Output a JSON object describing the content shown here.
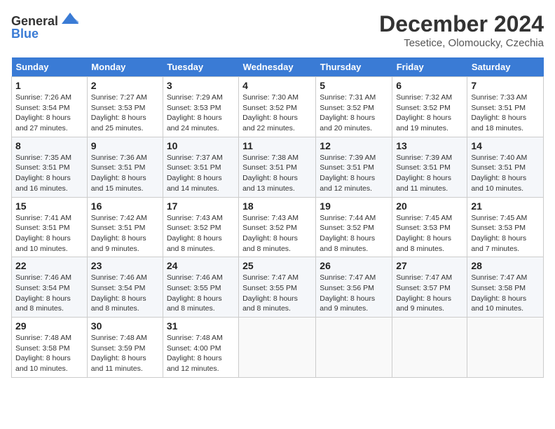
{
  "logo": {
    "text_general": "General",
    "text_blue": "Blue"
  },
  "header": {
    "month": "December 2024",
    "location": "Tesetice, Olomoucky, Czechia"
  },
  "weekdays": [
    "Sunday",
    "Monday",
    "Tuesday",
    "Wednesday",
    "Thursday",
    "Friday",
    "Saturday"
  ],
  "weeks": [
    [
      {
        "day": "1",
        "sunrise": "7:26 AM",
        "sunset": "3:54 PM",
        "daylight": "8 hours and 27 minutes."
      },
      {
        "day": "2",
        "sunrise": "7:27 AM",
        "sunset": "3:53 PM",
        "daylight": "8 hours and 25 minutes."
      },
      {
        "day": "3",
        "sunrise": "7:29 AM",
        "sunset": "3:53 PM",
        "daylight": "8 hours and 24 minutes."
      },
      {
        "day": "4",
        "sunrise": "7:30 AM",
        "sunset": "3:52 PM",
        "daylight": "8 hours and 22 minutes."
      },
      {
        "day": "5",
        "sunrise": "7:31 AM",
        "sunset": "3:52 PM",
        "daylight": "8 hours and 20 minutes."
      },
      {
        "day": "6",
        "sunrise": "7:32 AM",
        "sunset": "3:52 PM",
        "daylight": "8 hours and 19 minutes."
      },
      {
        "day": "7",
        "sunrise": "7:33 AM",
        "sunset": "3:51 PM",
        "daylight": "8 hours and 18 minutes."
      }
    ],
    [
      {
        "day": "8",
        "sunrise": "7:35 AM",
        "sunset": "3:51 PM",
        "daylight": "8 hours and 16 minutes."
      },
      {
        "day": "9",
        "sunrise": "7:36 AM",
        "sunset": "3:51 PM",
        "daylight": "8 hours and 15 minutes."
      },
      {
        "day": "10",
        "sunrise": "7:37 AM",
        "sunset": "3:51 PM",
        "daylight": "8 hours and 14 minutes."
      },
      {
        "day": "11",
        "sunrise": "7:38 AM",
        "sunset": "3:51 PM",
        "daylight": "8 hours and 13 minutes."
      },
      {
        "day": "12",
        "sunrise": "7:39 AM",
        "sunset": "3:51 PM",
        "daylight": "8 hours and 12 minutes."
      },
      {
        "day": "13",
        "sunrise": "7:39 AM",
        "sunset": "3:51 PM",
        "daylight": "8 hours and 11 minutes."
      },
      {
        "day": "14",
        "sunrise": "7:40 AM",
        "sunset": "3:51 PM",
        "daylight": "8 hours and 10 minutes."
      }
    ],
    [
      {
        "day": "15",
        "sunrise": "7:41 AM",
        "sunset": "3:51 PM",
        "daylight": "8 hours and 10 minutes."
      },
      {
        "day": "16",
        "sunrise": "7:42 AM",
        "sunset": "3:51 PM",
        "daylight": "8 hours and 9 minutes."
      },
      {
        "day": "17",
        "sunrise": "7:43 AM",
        "sunset": "3:52 PM",
        "daylight": "8 hours and 8 minutes."
      },
      {
        "day": "18",
        "sunrise": "7:43 AM",
        "sunset": "3:52 PM",
        "daylight": "8 hours and 8 minutes."
      },
      {
        "day": "19",
        "sunrise": "7:44 AM",
        "sunset": "3:52 PM",
        "daylight": "8 hours and 8 minutes."
      },
      {
        "day": "20",
        "sunrise": "7:45 AM",
        "sunset": "3:53 PM",
        "daylight": "8 hours and 8 minutes."
      },
      {
        "day": "21",
        "sunrise": "7:45 AM",
        "sunset": "3:53 PM",
        "daylight": "8 hours and 7 minutes."
      }
    ],
    [
      {
        "day": "22",
        "sunrise": "7:46 AM",
        "sunset": "3:54 PM",
        "daylight": "8 hours and 8 minutes."
      },
      {
        "day": "23",
        "sunrise": "7:46 AM",
        "sunset": "3:54 PM",
        "daylight": "8 hours and 8 minutes."
      },
      {
        "day": "24",
        "sunrise": "7:46 AM",
        "sunset": "3:55 PM",
        "daylight": "8 hours and 8 minutes."
      },
      {
        "day": "25",
        "sunrise": "7:47 AM",
        "sunset": "3:55 PM",
        "daylight": "8 hours and 8 minutes."
      },
      {
        "day": "26",
        "sunrise": "7:47 AM",
        "sunset": "3:56 PM",
        "daylight": "8 hours and 9 minutes."
      },
      {
        "day": "27",
        "sunrise": "7:47 AM",
        "sunset": "3:57 PM",
        "daylight": "8 hours and 9 minutes."
      },
      {
        "day": "28",
        "sunrise": "7:47 AM",
        "sunset": "3:58 PM",
        "daylight": "8 hours and 10 minutes."
      }
    ],
    [
      {
        "day": "29",
        "sunrise": "7:48 AM",
        "sunset": "3:58 PM",
        "daylight": "8 hours and 10 minutes."
      },
      {
        "day": "30",
        "sunrise": "7:48 AM",
        "sunset": "3:59 PM",
        "daylight": "8 hours and 11 minutes."
      },
      {
        "day": "31",
        "sunrise": "7:48 AM",
        "sunset": "4:00 PM",
        "daylight": "8 hours and 12 minutes."
      },
      null,
      null,
      null,
      null
    ]
  ]
}
